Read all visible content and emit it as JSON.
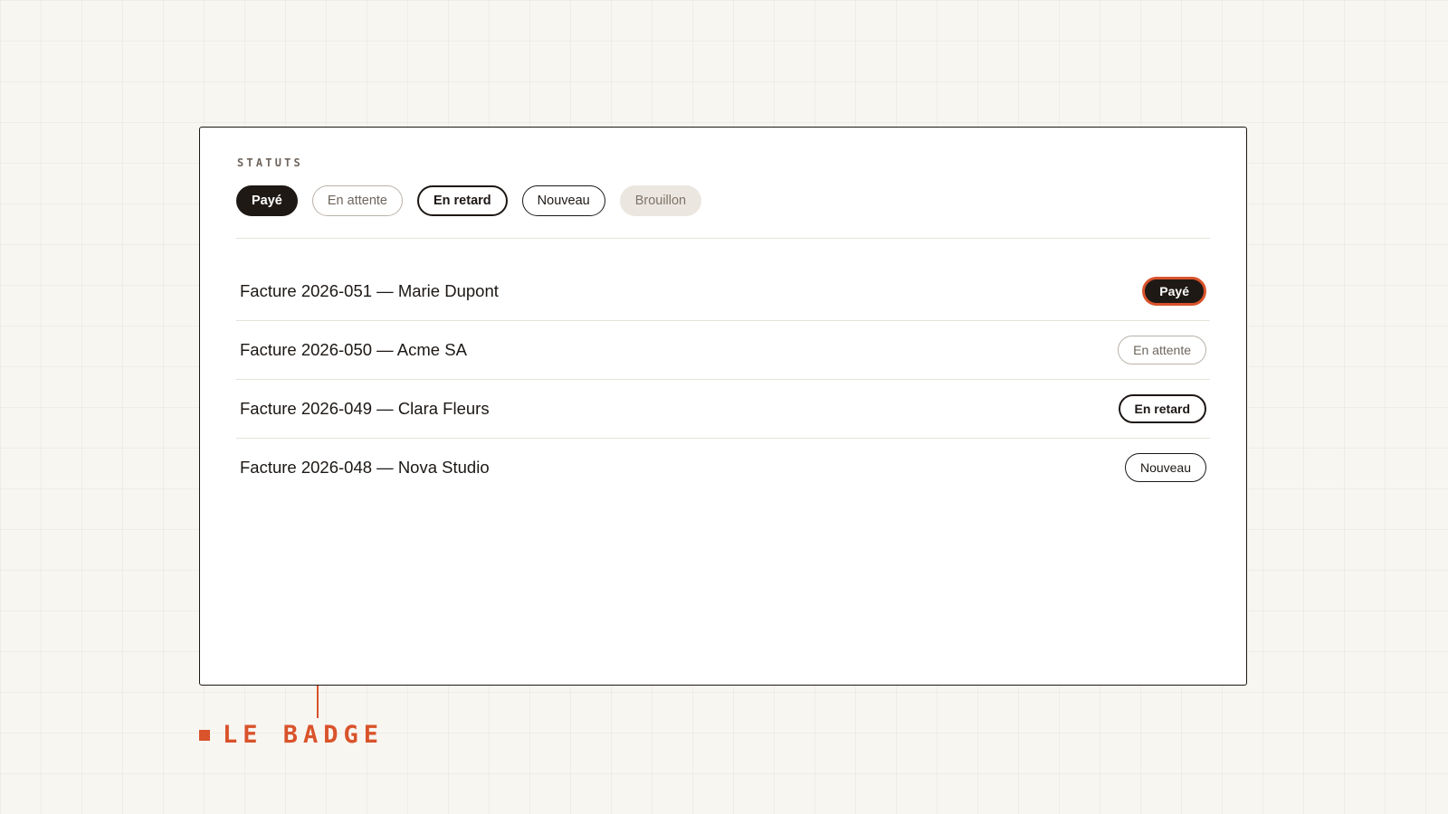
{
  "panel": {
    "section_label": "STATUTS",
    "status_badges": [
      {
        "label": "Payé",
        "variant": "paye"
      },
      {
        "label": "En attente",
        "variant": "attente"
      },
      {
        "label": "En retard",
        "variant": "retard"
      },
      {
        "label": "Nouveau",
        "variant": "nouveau"
      },
      {
        "label": "Brouillon",
        "variant": "brouillon"
      }
    ],
    "invoices": [
      {
        "title": "Facture 2026-051 — Marie Dupont",
        "status": "Payé",
        "focused": true
      },
      {
        "title": "Facture 2026-050 — Acme SA",
        "status": "En attente",
        "focused": false
      },
      {
        "title": "Facture 2026-049 — Clara Fleurs",
        "status": "En retard",
        "focused": false
      },
      {
        "title": "Facture 2026-048 — Nova Studio",
        "status": "Nouveau",
        "focused": false
      }
    ]
  },
  "caption": {
    "text": "LE BADGE"
  },
  "colors": {
    "background": "#f8f6f1",
    "ink": "#1c1714",
    "accent": "#d9532b",
    "muted_text": "#6e655d",
    "draft_fill": "#ebe6df"
  }
}
